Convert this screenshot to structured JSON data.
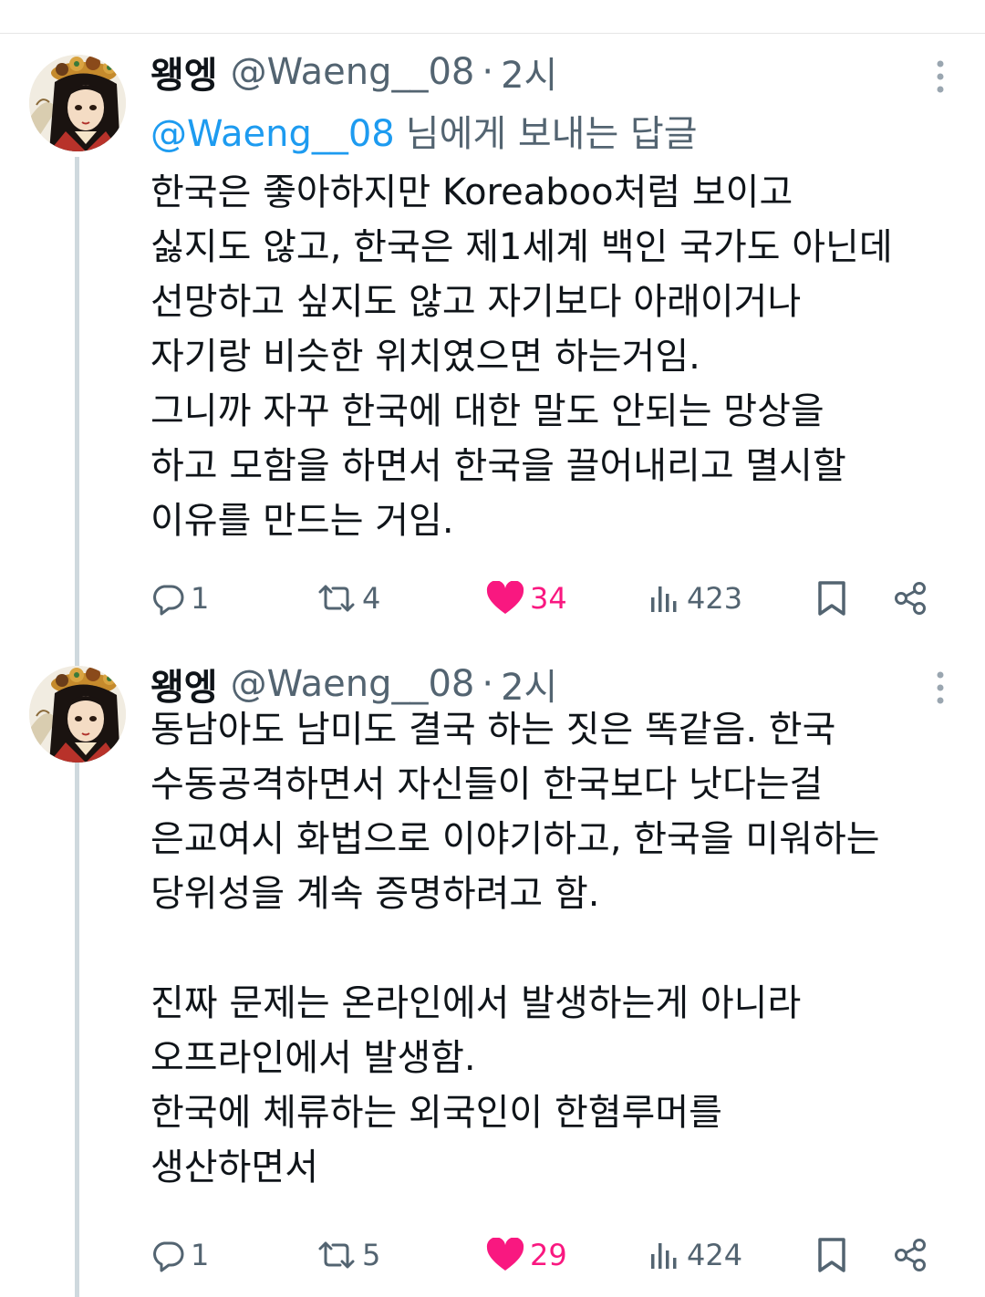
{
  "tweets": [
    {
      "name": "왱엥",
      "handle": "@Waeng__08",
      "separator": "·",
      "time": "2시",
      "reply_to": {
        "mention": "@Waeng__08",
        "suffix": "님에게 보내는 답글"
      },
      "lines": [
        "한국은 좋아하지만 Koreaboo처럼 보이고",
        "싫지도 않고, 한국은 제1세계 백인 국가도 아닌데",
        "선망하고 싶지도 않고 자기보다 아래이거나",
        "자기랑 비슷한 위치였으면 하는거임.",
        "그니까 자꾸 한국에 대한 말도 안되는 망상을",
        "하고 모함을 하면서 한국을 끌어내리고 멸시할",
        "이유를 만드는 거임."
      ],
      "stats": {
        "replies": "1",
        "retweets": "4",
        "likes": "34",
        "views": "423"
      }
    },
    {
      "name": "왱엥",
      "handle": "@Waeng__08",
      "separator": "·",
      "time": "2시",
      "lines": [
        "동남아도 남미도 결국 하는 짓은 똑같음. 한국",
        "수동공격하면서 자신들이 한국보다 낫다는걸",
        "은교여시 화법으로 이야기하고, 한국을 미워하는",
        "당위성을 계속 증명하려고 함.",
        "",
        "진짜 문제는 온라인에서 발생하는게 아니라",
        "오프라인에서 발생함.",
        "한국에 체류하는 외국인이 한혐루머를",
        "생산하면서"
      ],
      "stats": {
        "replies": "1",
        "retweets": "5",
        "likes": "29",
        "views": "424"
      }
    }
  ],
  "icons": {
    "reply": "reply-icon",
    "retweet": "retweet-icon",
    "like": "heart-icon",
    "views": "views-icon",
    "bookmark": "bookmark-icon",
    "share": "share-icon",
    "more": "more-options-icon"
  },
  "colors": {
    "text": "#0f1419",
    "secondary": "#536471",
    "link": "#1d9bf0",
    "like": "#f91880",
    "thread_line": "#cfd9de"
  }
}
